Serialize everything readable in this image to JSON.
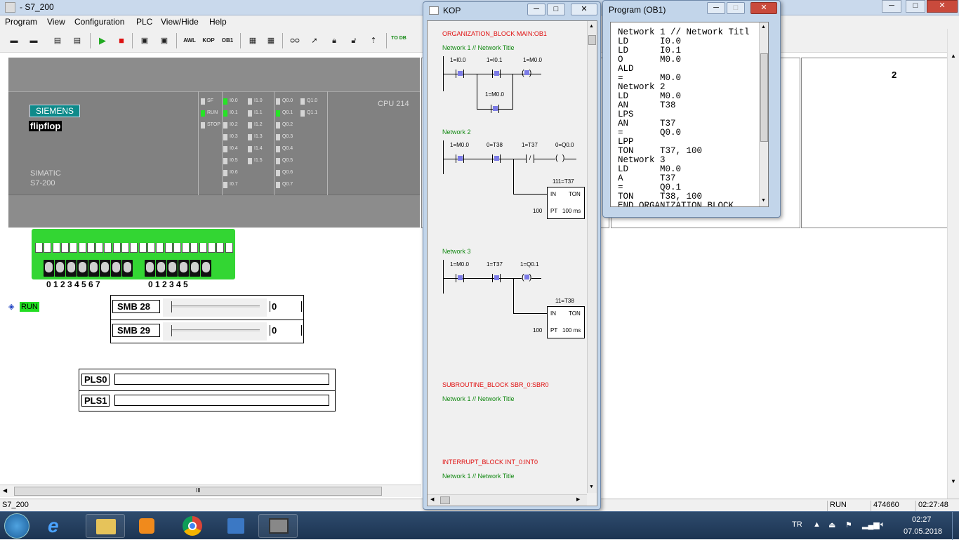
{
  "app": {
    "title": "- S7_200"
  },
  "menu": [
    "Program",
    "View",
    "Configuration",
    "PLC",
    "View/Hide",
    "Help"
  ],
  "toolbar": {
    "awl": "AWL",
    "kop": "KOP",
    "ob1": "OB1",
    "todb": "TO DB"
  },
  "plc": {
    "brand": "SIEMENS",
    "project": "flipflop",
    "family": "SIMATIC",
    "model": "S7-200",
    "cpu": "CPU 214",
    "status_leds": [
      {
        "label": "SF",
        "on": false
      },
      {
        "label": "RUN",
        "on": true
      },
      {
        "label": "STOP",
        "on": false
      }
    ],
    "inputs_a": [
      "I0.0",
      "I0.1",
      "I0.2",
      "I0.3",
      "I0.4",
      "I0.5",
      "I0.6",
      "I0.7"
    ],
    "inputs_a_on": [
      true,
      true,
      false,
      false,
      false,
      false,
      false,
      false
    ],
    "inputs_b": [
      "I1.0",
      "I1.1",
      "I1.2",
      "I1.3",
      "I1.4",
      "I1.5"
    ],
    "outputs_a": [
      "Q0.0",
      "Q0.1",
      "Q0.2",
      "Q0.3",
      "Q0.4",
      "Q0.5",
      "Q0.6",
      "Q0.7"
    ],
    "outputs_a_on": [
      false,
      true,
      false,
      false,
      false,
      false,
      false,
      false
    ],
    "outputs_b": [
      "Q1.0",
      "Q1.1"
    ],
    "input_numbers": "0 1 2 3 4 5 6 7",
    "output_numbers": "0 1 2 3 4 5"
  },
  "run": {
    "label": "RUN"
  },
  "smb": [
    {
      "label": "SMB 28",
      "value": "0",
      "level": 0
    },
    {
      "label": "SMB 29",
      "value": "0",
      "level": 0
    }
  ],
  "pls": [
    {
      "label": "PLS0",
      "value": ""
    },
    {
      "label": "PLS1",
      "value": ""
    }
  ],
  "right": {
    "panel2_text": "2"
  },
  "hscroll": {
    "grip": "III"
  },
  "status": {
    "left": "S7_200",
    "mode": "RUN",
    "counter": "474660",
    "time": "02:27:48"
  },
  "kop": {
    "title": "KOP",
    "ob_title": "ORGANIZATION_BLOCK MAIN:OB1",
    "n1_title": "Network 1 // Network Title",
    "n1": {
      "c1": "1=I0.0",
      "c2": "1=I0.1",
      "coil": "1=M0.0",
      "c3": "1=M0.0"
    },
    "n2_title": "Network 2",
    "n2": {
      "c1": "1=M0.0",
      "c2": "0=T38",
      "c3": "1=T37",
      "coil": "0=Q0.0",
      "timer": "111=T37",
      "in": "IN",
      "ton": "TON",
      "pt": "PT",
      "preset": "100",
      "base": "100 ms"
    },
    "n3_title": "Network 3",
    "n3": {
      "c1": "1=M0.0",
      "c2": "1=T37",
      "coil": "1=Q0.1",
      "timer": "11=T38",
      "in": "IN",
      "ton": "TON",
      "pt": "PT",
      "preset": "100",
      "base": "100 ms"
    },
    "sbr_title": "SUBROUTINE_BLOCK SBR_0:SBR0",
    "sbr_net": "Network 1 // Network Title",
    "int_title": "INTERRUPT_BLOCK INT_0:INT0",
    "int_net": "Network 1 // Network Title"
  },
  "prog": {
    "title": "Program (OB1)",
    "lines": [
      "Network 1 // Network Titl",
      "LD      I0.0",
      "LD      I0.1",
      "O       M0.0",
      "ALD",
      "=       M0.0",
      "Network 2",
      "LD      M0.0",
      "AN      T38",
      "LPS",
      "AN      T37",
      "=       Q0.0",
      "LPP",
      "TON     T37, 100",
      "Network 3",
      "LD      M0.0",
      "A       T37",
      "=       Q0.1",
      "TON     T38, 100",
      "END_ORGANIZATION_BLOCK"
    ]
  },
  "taskbar": {
    "lang": "TR",
    "time": "02:27",
    "date": "07.05.2018"
  },
  "colors": {
    "led_on": "#26e426",
    "connector": "#33d633",
    "kop_red": "#e01010",
    "kop_green": "#118811",
    "contact": "#7b7be6"
  }
}
